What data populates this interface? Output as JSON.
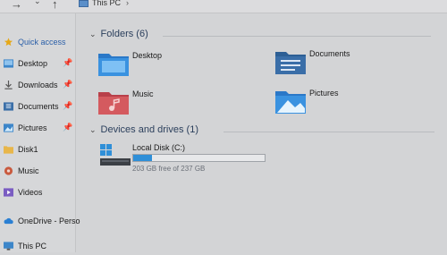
{
  "toolbar": {
    "back_glyph": "→",
    "dropdown_glyph": "⌄",
    "up_glyph": "↑"
  },
  "breadcrumb": {
    "location": "This PC",
    "separator": "›"
  },
  "sidebar": {
    "items": [
      {
        "label": "Quick access",
        "icon": "star-icon",
        "pinned": false
      },
      {
        "label": "Desktop",
        "icon": "desktop-folder-icon",
        "pinned": true
      },
      {
        "label": "Downloads",
        "icon": "download-icon",
        "pinned": true
      },
      {
        "label": "Documents",
        "icon": "documents-folder-icon",
        "pinned": true
      },
      {
        "label": "Pictures",
        "icon": "pictures-folder-icon",
        "pinned": true
      },
      {
        "label": "Disk1",
        "icon": "folder-icon",
        "pinned": false
      },
      {
        "label": "Music",
        "icon": "music-icon",
        "pinned": false
      },
      {
        "label": "Videos",
        "icon": "videos-icon",
        "pinned": false
      },
      {
        "label": "OneDrive - Perso",
        "icon": "cloud-icon",
        "pinned": false
      },
      {
        "label": "This PC",
        "icon": "this-pc-icon",
        "pinned": false
      }
    ],
    "pin_glyph": "📌"
  },
  "folders_section": {
    "title": "Folders (6)",
    "chevron": "⌄",
    "folders": [
      {
        "label": "Desktop",
        "icon": "desktop-folder-icon"
      },
      {
        "label": "Documents",
        "icon": "documents-folder-icon"
      },
      {
        "label": "Music",
        "icon": "music-folder-icon"
      },
      {
        "label": "Pictures",
        "icon": "pictures-folder-icon"
      }
    ]
  },
  "devices_section": {
    "title": "Devices and drives (1)",
    "chevron": "⌄",
    "drives": [
      {
        "label": "Local Disk (C:)",
        "free_text": "203 GB free of 237 GB",
        "used_fraction": 0.14,
        "icon": "windows-drive-icon"
      }
    ]
  },
  "colors": {
    "folder_blue": "#2f8fd8",
    "drive_fill": "#2f8fd8",
    "section_text": "#2b3f5c"
  }
}
